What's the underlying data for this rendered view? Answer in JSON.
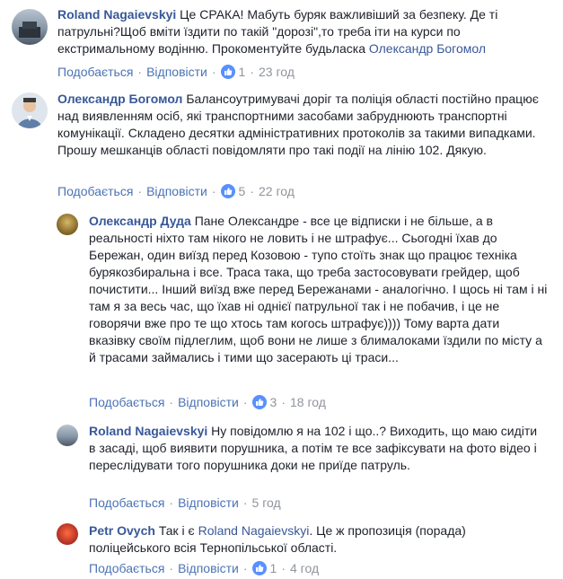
{
  "comments": [
    {
      "author": "Roland Nagaievskyi",
      "text": "Це СРАКА! Мабуть буряк важливіший за безпеку. Де ті патрульні?Щоб вміти їздити по такій \"дорозі\",то треба іти на курси по екстримальному водінню. Прокоментуйте будьласка",
      "mention": "Олександр Богомол",
      "like_label": "Подобається",
      "reply_label": "Відповісти",
      "likes": "1",
      "time": "23 год",
      "avatar_color": "#6f7f8f"
    },
    {
      "author": "Олександр Богомол",
      "text": "Балансоутримувачі доріг та поліція області постійно працює над виявленням осіб, які транспортними засобами забруднюють транспортні комунікації. Складено десятки адміністративних протоколів за такими випадками. Прошу мешканців області повідомляти про такі події на лінію 102. Дякую.",
      "like_label": "Подобається",
      "reply_label": "Відповісти",
      "likes": "5",
      "time": "22 год",
      "avatar_color": "#a7b4c4"
    },
    {
      "author": "Олександр Дуда",
      "text": "Пане Олександре - все це відписки і не більше, а в реальності ніхто там нікого не ловить і не штрафує... Сьогодні їхав до Бережан, один виїзд перед Козовою - тупо стоїть знак що працює техніка бурякозбиральна і все. Траса така, що треба застосовувати грейдер, щоб почистити... Інший виїзд вже перед Бережанами - аналогічно. І щось ні там і ні там я за весь час, що їхав ні однієї патрульної так і не побачив, і це не говорячи вже про те що хтось там когось штрафує)))) Тому варта дати вказівку своїм підлеглим, щоб вони не лише з блималоками їздили по місту а й трасами займались і тими що засерають ці траси...",
      "like_label": "Подобається",
      "reply_label": "Відповісти",
      "likes": "3",
      "time": "18 год",
      "avatar_color": "#8a7a3c"
    },
    {
      "author": "Roland Nagaievskyi",
      "text": "Ну повідомлю я на 102 і що..? Виходить, що маю сидіти в засаді, щоб виявити порушника, а потім те все зафіксувати на фото відео і переслідувати того порушника доки не приїде патруль.",
      "like_label": "Подобається",
      "reply_label": "Відповісти",
      "time": "5 год",
      "avatar_color": "#6f7f8f"
    },
    {
      "author": "Petr Ovych",
      "text_before": "Так і є",
      "mention": "Roland Nagaievskyi",
      "text": ". Це ж пропозиція (порада) поліцейського всія Тернопільської області.",
      "like_label": "Подобається",
      "reply_label": "Відповісти",
      "likes": "1",
      "time": "4 год",
      "avatar_color": "#c0392b"
    }
  ]
}
